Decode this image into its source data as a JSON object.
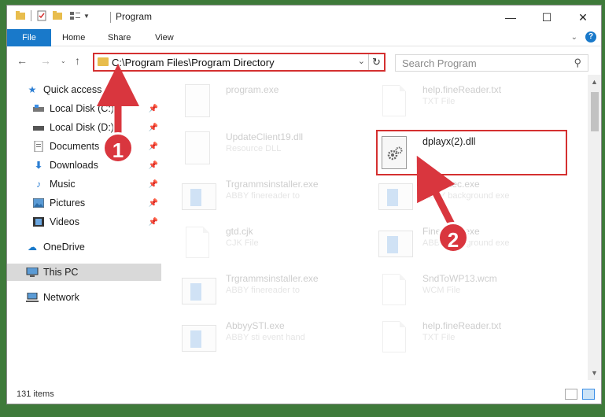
{
  "window": {
    "title": "Program"
  },
  "ribbon": {
    "tabs": [
      "File",
      "Home",
      "Share",
      "View"
    ]
  },
  "nav": {
    "address": "C:\\Program Files\\Program Directory",
    "search_placeholder": "Search Program"
  },
  "sidebar": {
    "items": [
      {
        "label": "Quick access",
        "icon": "star-icon"
      },
      {
        "label": "Local Disk (C:)",
        "icon": "drive-icon"
      },
      {
        "label": "Local Disk (D:)",
        "icon": "drive-icon"
      },
      {
        "label": "Documents",
        "icon": "documents-icon"
      },
      {
        "label": "Downloads",
        "icon": "download-icon"
      },
      {
        "label": "Music",
        "icon": "music-icon"
      },
      {
        "label": "Pictures",
        "icon": "pictures-icon"
      },
      {
        "label": "Videos",
        "icon": "videos-icon"
      },
      {
        "label": "OneDrive",
        "icon": "cloud-icon"
      },
      {
        "label": "This PC",
        "icon": "computer-icon"
      },
      {
        "label": "Network",
        "icon": "network-icon"
      }
    ]
  },
  "files": {
    "left": [
      {
        "name": "program.exe",
        "type": ""
      },
      {
        "name": "UpdateClient19.dll",
        "type": "Resource DLL"
      },
      {
        "name": "Trgrammsinstaller.exe",
        "type": "ABBY finereader to"
      },
      {
        "name": "gtd.cjk",
        "type": "CJK File"
      },
      {
        "name": "Trgrammsinstaller.exe",
        "type": "ABBY finereader to"
      },
      {
        "name": "AbbyySTI.exe",
        "type": "ABBY sti event hand"
      }
    ],
    "right": [
      {
        "name": "help.fineReader.txt",
        "type": "TXT File"
      },
      {
        "name": "dplayx(2).dll",
        "type": ""
      },
      {
        "name": "FineExec.exe",
        "type": "ABBY background exe"
      },
      {
        "name": "FineExec.exe",
        "type": "ABBY background exe"
      },
      {
        "name": "SndToWP13.wcm",
        "type": "WCM File"
      },
      {
        "name": "help.fineReader.txt",
        "type": "TXT File"
      }
    ]
  },
  "status": {
    "count": "131 items"
  },
  "annotations": {
    "callout1": "1",
    "callout2": "2",
    "color": "#d9363e"
  }
}
